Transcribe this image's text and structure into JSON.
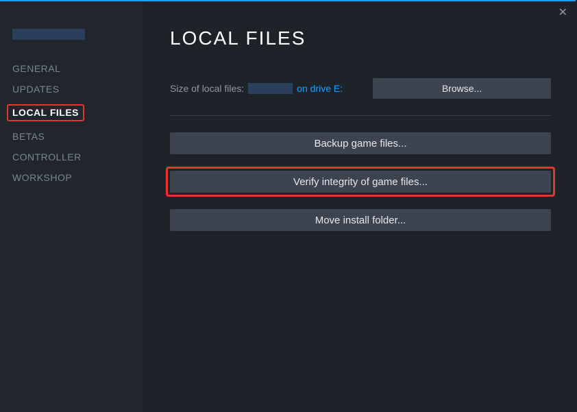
{
  "close_icon": "✕",
  "sidebar": {
    "items": [
      {
        "label": "GENERAL"
      },
      {
        "label": "UPDATES"
      },
      {
        "label": "LOCAL FILES"
      },
      {
        "label": "BETAS"
      },
      {
        "label": "CONTROLLER"
      },
      {
        "label": "WORKSHOP"
      }
    ]
  },
  "main": {
    "title": "LOCAL FILES",
    "size_label": "Size of local files:",
    "drive_text": "on drive E:",
    "browse_label": "Browse...",
    "backup_label": "Backup game files...",
    "verify_label": "Verify integrity of game files...",
    "move_label": "Move install folder..."
  }
}
